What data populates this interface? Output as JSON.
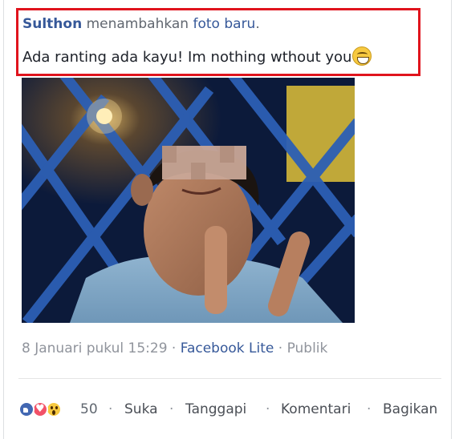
{
  "post": {
    "author": "Sulthon",
    "action": "menambahkan",
    "object_link": "foto baru",
    "period": ".",
    "caption": "Ada ranting ada kayu! Im nothing wthout you",
    "caption_emoji": "laughing-face-icon"
  },
  "meta": {
    "date": "8 Januari pukul 15:29",
    "sep1": "·",
    "app": "Facebook Lite",
    "sep2": "·",
    "privacy": "Publik"
  },
  "reactions": {
    "icons": [
      "like-reaction-icon",
      "love-reaction-icon",
      "wow-reaction-icon"
    ],
    "count": "50"
  },
  "actions": {
    "like": "Suka",
    "reply": "Tanggapi",
    "comment": "Komentari",
    "share": "Bagikan",
    "separator": "·"
  },
  "colors": {
    "highlight_border": "#e0141d",
    "link_blue": "#365899",
    "meta_gray": "#90949c"
  }
}
